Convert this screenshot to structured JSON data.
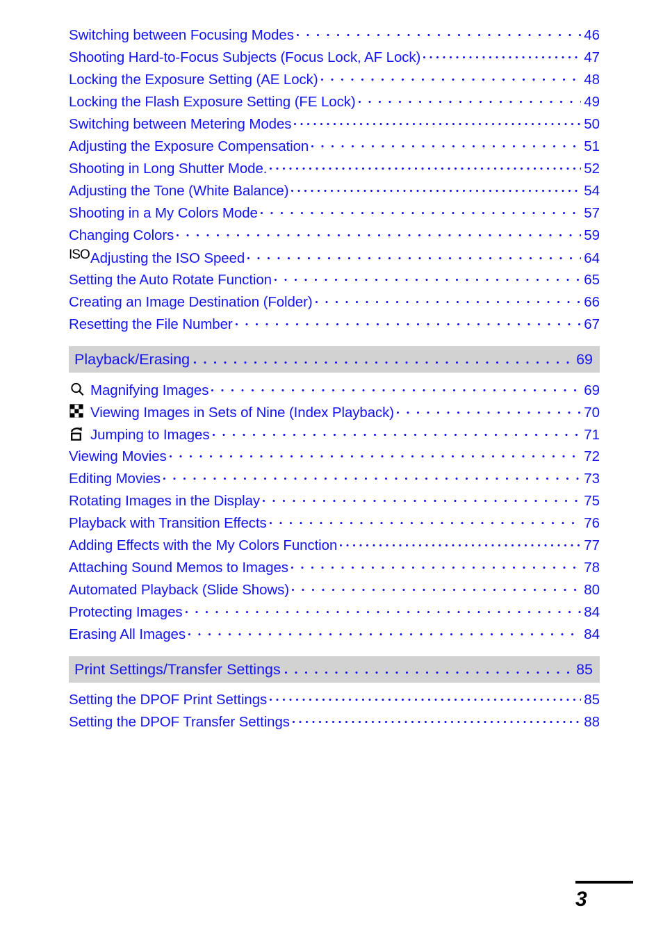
{
  "document": {
    "page_number": "3"
  },
  "toc": {
    "top_entries": [
      {
        "icon": "none",
        "title": "Switching between Focusing Modes",
        "page": "46",
        "leader": "normal"
      },
      {
        "icon": "none",
        "title": "Shooting Hard-to-Focus Subjects (Focus Lock, AF Lock)",
        "page": "47",
        "leader": "tight"
      },
      {
        "icon": "none",
        "title": "Locking the Exposure Setting (AE Lock)",
        "page": "48",
        "leader": "normal"
      },
      {
        "icon": "none",
        "title": "Locking the Flash Exposure Setting (FE Lock)",
        "page": "49",
        "leader": "normal"
      },
      {
        "icon": "none",
        "title": "Switching between Metering Modes",
        "page": "50",
        "leader": "tight"
      },
      {
        "icon": "none",
        "title": "Adjusting the Exposure Compensation",
        "page": "51",
        "leader": "normal"
      },
      {
        "icon": "none",
        "title": "Shooting in Long Shutter Mode.",
        "page": "52",
        "leader": "tight"
      },
      {
        "icon": "none",
        "title": "Adjusting the Tone (White Balance)",
        "page": "54",
        "leader": "tight"
      },
      {
        "icon": "none",
        "title": "Shooting in a My Colors Mode",
        "page": "57",
        "leader": "normal"
      },
      {
        "icon": "none",
        "title": "Changing Colors",
        "page": "59",
        "leader": "normal"
      },
      {
        "icon": "iso-icon",
        "title": "Adjusting the ISO Speed",
        "page": "64",
        "leader": "normal"
      },
      {
        "icon": "none",
        "title": "Setting the Auto Rotate Function",
        "page": "65",
        "leader": "normal"
      },
      {
        "icon": "none",
        "title": "Creating an Image Destination (Folder)",
        "page": "66",
        "leader": "normal"
      },
      {
        "icon": "none",
        "title": "Resetting the File Number",
        "page": "67",
        "leader": "normal"
      }
    ],
    "sections": [
      {
        "heading": "Playback/Erasing",
        "heading_page": "69",
        "entries": [
          {
            "icon": "magnifier-icon",
            "title": "Magnifying Images",
            "page": "69",
            "leader": "normal"
          },
          {
            "icon": "index-grid-icon",
            "title": "Viewing Images in Sets of Nine (Index Playback)",
            "page": "70",
            "leader": "normal"
          },
          {
            "icon": "jump-icon",
            "title": "Jumping to Images",
            "page": "71",
            "leader": "normal"
          },
          {
            "icon": "none",
            "title": "Viewing Movies",
            "page": "72",
            "leader": "normal"
          },
          {
            "icon": "none",
            "title": "Editing Movies",
            "page": "73",
            "leader": "normal"
          },
          {
            "icon": "none",
            "title": "Rotating Images in the Display",
            "page": "75",
            "leader": "normal"
          },
          {
            "icon": "none",
            "title": "Playback with Transition Effects",
            "page": "76",
            "leader": "normal"
          },
          {
            "icon": "none",
            "title": "Adding Effects with the My Colors Function",
            "page": "77",
            "leader": "tight"
          },
          {
            "icon": "none",
            "title": "Attaching Sound Memos to Images",
            "page": "78",
            "leader": "normal"
          },
          {
            "icon": "none",
            "title": "Automated Playback (Slide Shows)",
            "page": "80",
            "leader": "normal"
          },
          {
            "icon": "none",
            "title": "Protecting Images",
            "page": "84",
            "leader": "normal"
          },
          {
            "icon": "none",
            "title": "Erasing All Images",
            "page": "84",
            "leader": "normal"
          }
        ]
      },
      {
        "heading": "Print Settings/Transfer Settings",
        "heading_page": "85",
        "entries": [
          {
            "icon": "none",
            "title": "Setting the DPOF Print Settings",
            "page": "85",
            "leader": "tight"
          },
          {
            "icon": "none",
            "title": "Setting the DPOF Transfer Settings",
            "page": "88",
            "leader": "tight"
          }
        ]
      }
    ]
  },
  "colors": {
    "link_blue": "#1414f0",
    "section_band_gray": "#d2d2d2",
    "icon_black": "#000000",
    "page_background": "#ffffff"
  },
  "icons": {
    "iso_label": "ISO"
  }
}
